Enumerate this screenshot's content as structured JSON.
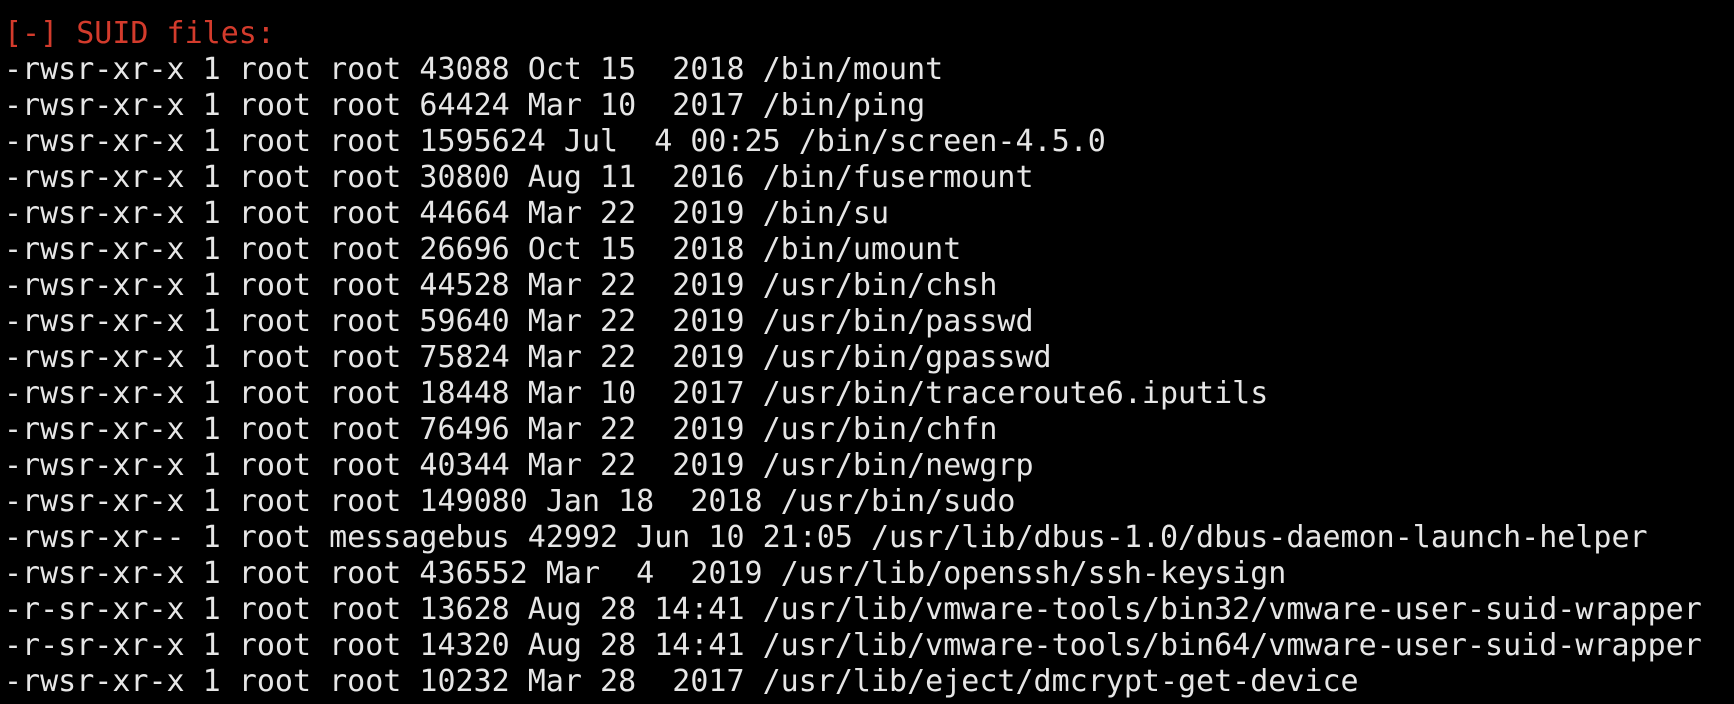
{
  "terminal": {
    "header": "[-] SUID files:",
    "lines": [
      "-rwsr-xr-x 1 root root 43088 Oct 15  2018 /bin/mount",
      "-rwsr-xr-x 1 root root 64424 Mar 10  2017 /bin/ping",
      "-rwsr-xr-x 1 root root 1595624 Jul  4 00:25 /bin/screen-4.5.0",
      "-rwsr-xr-x 1 root root 30800 Aug 11  2016 /bin/fusermount",
      "-rwsr-xr-x 1 root root 44664 Mar 22  2019 /bin/su",
      "-rwsr-xr-x 1 root root 26696 Oct 15  2018 /bin/umount",
      "-rwsr-xr-x 1 root root 44528 Mar 22  2019 /usr/bin/chsh",
      "-rwsr-xr-x 1 root root 59640 Mar 22  2019 /usr/bin/passwd",
      "-rwsr-xr-x 1 root root 75824 Mar 22  2019 /usr/bin/gpasswd",
      "-rwsr-xr-x 1 root root 18448 Mar 10  2017 /usr/bin/traceroute6.iputils",
      "-rwsr-xr-x 1 root root 76496 Mar 22  2019 /usr/bin/chfn",
      "-rwsr-xr-x 1 root root 40344 Mar 22  2019 /usr/bin/newgrp",
      "-rwsr-xr-x 1 root root 149080 Jan 18  2018 /usr/bin/sudo",
      "-rwsr-xr-- 1 root messagebus 42992 Jun 10 21:05 /usr/lib/dbus-1.0/dbus-daemon-launch-helper",
      "-rwsr-xr-x 1 root root 436552 Mar  4  2019 /usr/lib/openssh/ssh-keysign",
      "-r-sr-xr-x 1 root root 13628 Aug 28 14:41 /usr/lib/vmware-tools/bin32/vmware-user-suid-wrapper",
      "-r-sr-xr-x 1 root root 14320 Aug 28 14:41 /usr/lib/vmware-tools/bin64/vmware-user-suid-wrapper",
      "-rwsr-xr-x 1 root root 10232 Mar 28  2017 /usr/lib/eject/dmcrypt-get-device"
    ]
  },
  "colors": {
    "background": "#000000",
    "text": "#e6e6e6",
    "header": "#d33b2c"
  }
}
